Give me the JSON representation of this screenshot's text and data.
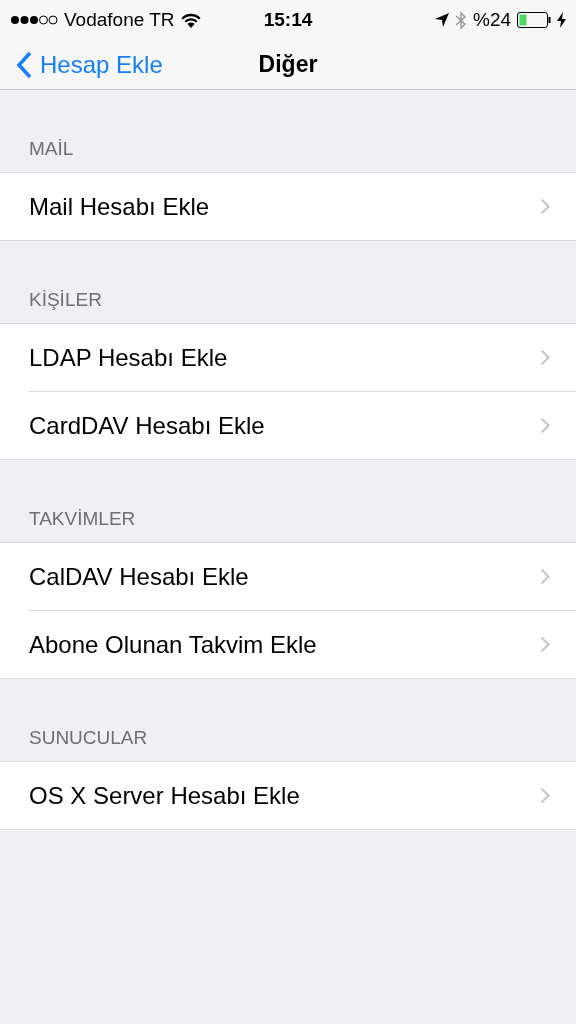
{
  "status_bar": {
    "carrier": "Vodafone TR",
    "time": "15:14",
    "battery": "%24"
  },
  "nav": {
    "back": "Hesap Ekle",
    "title": "Diğer"
  },
  "sections": [
    {
      "header": "MAİL",
      "rows": [
        {
          "label": "Mail Hesabı Ekle"
        }
      ]
    },
    {
      "header": "KİŞİLER",
      "rows": [
        {
          "label": "LDAP Hesabı Ekle"
        },
        {
          "label": "CardDAV Hesabı Ekle"
        }
      ]
    },
    {
      "header": "TAKVİMLER",
      "rows": [
        {
          "label": "CalDAV Hesabı Ekle"
        },
        {
          "label": "Abone Olunan Takvim Ekle"
        }
      ]
    },
    {
      "header": "SUNUCULAR",
      "rows": [
        {
          "label": "OS X Server Hesabı Ekle"
        }
      ]
    }
  ]
}
